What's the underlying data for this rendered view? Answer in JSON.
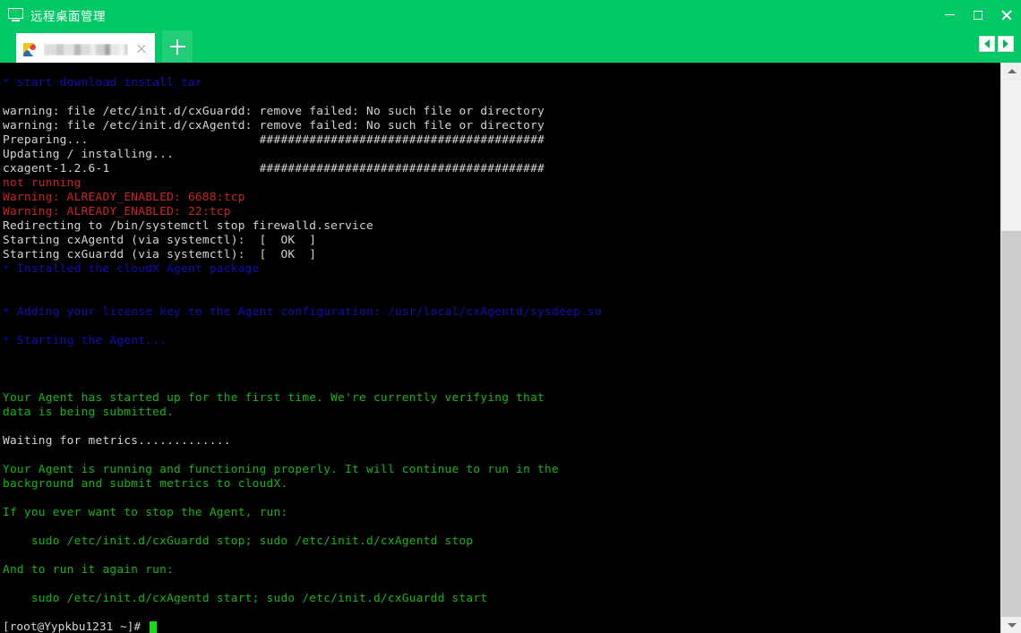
{
  "window": {
    "title": "远程桌面管理",
    "icon": "monitor-icon",
    "controls": {
      "minimize": "—",
      "maximize": "□",
      "close": "✕"
    }
  },
  "tabs": {
    "items": [
      {
        "label": "",
        "redacted": true,
        "favicon": "remote-session-icon",
        "close": "✕",
        "active": true
      }
    ],
    "add_label": "+",
    "nav_prev": "◀",
    "nav_next": "▶"
  },
  "terminal": {
    "background": "#000000",
    "colors": {
      "white": "#d4d4d4",
      "red": "#cc2222",
      "green": "#12b512",
      "blue": "#0d0db4",
      "cursor": "#12dd12"
    },
    "lines": [
      {
        "text": "* start download install_tar",
        "color": "blue"
      },
      {
        "text": "",
        "color": "white"
      },
      {
        "text": "warning: file /etc/init.d/cxGuardd: remove failed: No such file or directory",
        "color": "white"
      },
      {
        "text": "warning: file /etc/init.d/cxAgentd: remove failed: No such file or directory",
        "color": "white"
      },
      {
        "text": "Preparing...                        ########################################",
        "color": "white"
      },
      {
        "text": "Updating / installing...",
        "color": "white"
      },
      {
        "text": "cxagent-1.2.6-1                     ########################################",
        "color": "white"
      },
      {
        "text": "not running",
        "color": "red"
      },
      {
        "text": "Warning: ALREADY_ENABLED: 6688:tcp",
        "color": "red"
      },
      {
        "text": "Warning: ALREADY_ENABLED: 22:tcp",
        "color": "red"
      },
      {
        "text": "Redirecting to /bin/systemctl stop firewalld.service",
        "color": "white"
      },
      {
        "text": "Starting cxAgentd (via systemctl):  [  OK  ]",
        "color": "white"
      },
      {
        "text": "Starting cxGuardd (via systemctl):  [  OK  ]",
        "color": "white"
      },
      {
        "text": "* Installed the cloudX Agent package",
        "color": "blue"
      },
      {
        "text": "",
        "color": "white"
      },
      {
        "text": "",
        "color": "white"
      },
      {
        "text": "* Adding your license key to the Agent configuration: /usr/local/cxAgentd/sysdeep.so",
        "color": "blue"
      },
      {
        "text": "",
        "color": "white"
      },
      {
        "text": "* Starting the Agent...",
        "color": "blue"
      },
      {
        "text": "",
        "color": "white"
      },
      {
        "text": "",
        "color": "white"
      },
      {
        "text": "",
        "color": "white"
      },
      {
        "text": "Your Agent has started up for the first time. We're currently verifying that",
        "color": "green"
      },
      {
        "text": "data is being submitted.",
        "color": "green"
      },
      {
        "text": "",
        "color": "white"
      },
      {
        "text": "Waiting for metrics.............",
        "color": "white"
      },
      {
        "text": "",
        "color": "white"
      },
      {
        "text": "Your Agent is running and functioning properly. It will continue to run in the",
        "color": "green"
      },
      {
        "text": "background and submit metrics to cloudX.",
        "color": "green"
      },
      {
        "text": "",
        "color": "white"
      },
      {
        "text": "If you ever want to stop the Agent, run:",
        "color": "green"
      },
      {
        "text": "",
        "color": "white"
      },
      {
        "text": "    sudo /etc/init.d/cxGuardd stop; sudo /etc/init.d/cxAgentd stop",
        "color": "green"
      },
      {
        "text": "",
        "color": "white"
      },
      {
        "text": "And to run it again run:",
        "color": "green"
      },
      {
        "text": "",
        "color": "white"
      },
      {
        "text": "    sudo /etc/init.d/cxAgentd start; sudo /etc/init.d/cxGuardd start",
        "color": "green"
      },
      {
        "text": "",
        "color": "white"
      }
    ],
    "prompt": "[root@Yypkbu1231 ~]# ",
    "cursor": "block"
  },
  "scrollbar": {
    "up_arrow": "▲",
    "down_arrow": "▼"
  },
  "theme": {
    "accent_green": "#00c864",
    "tab_active_bg": "#ffffff",
    "terminal_bg": "#000000"
  }
}
